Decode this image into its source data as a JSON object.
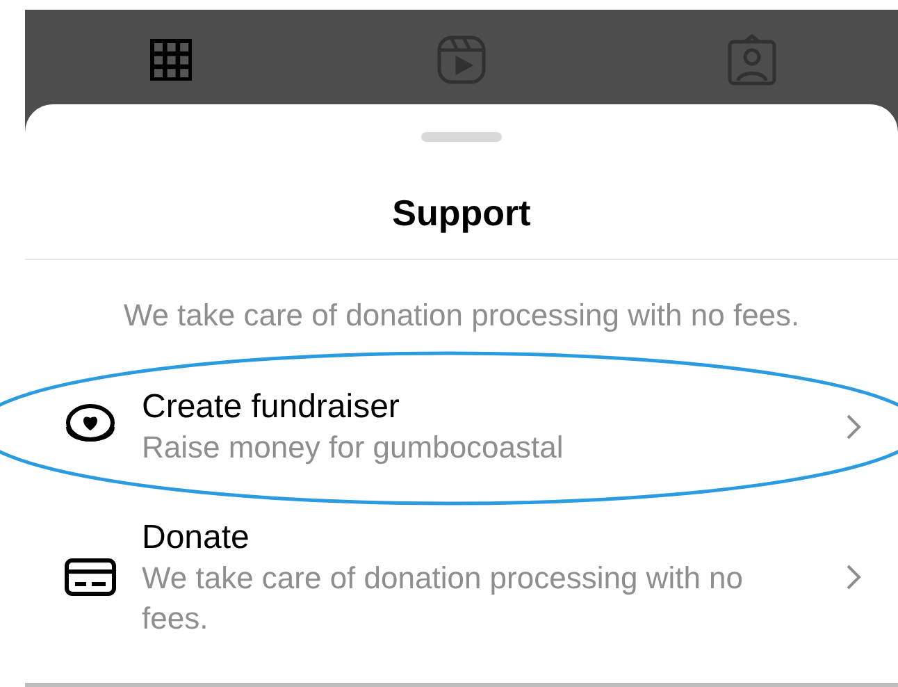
{
  "profile_tabs": [
    {
      "kind": "grid",
      "selected": true
    },
    {
      "kind": "reels",
      "selected": false
    },
    {
      "kind": "tagged",
      "selected": false
    }
  ],
  "sheet": {
    "title": "Support",
    "subtitle": "We take care of donation processing with no fees.",
    "options": [
      {
        "kind": "fundraiser",
        "label": "Create fundraiser",
        "description": "Raise money for gumbocoastal",
        "highlighted": true
      },
      {
        "kind": "donate",
        "label": "Donate",
        "description": "We take care of donation processing with no fees.",
        "highlighted": false
      }
    ]
  }
}
